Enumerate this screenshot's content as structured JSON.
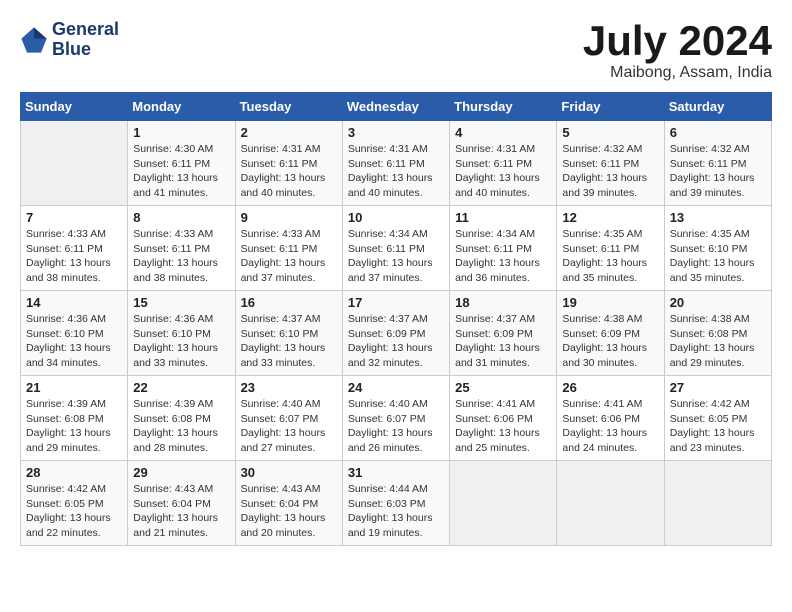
{
  "header": {
    "logo_line1": "General",
    "logo_line2": "Blue",
    "month_year": "July 2024",
    "location": "Maibong, Assam, India"
  },
  "weekdays": [
    "Sunday",
    "Monday",
    "Tuesday",
    "Wednesday",
    "Thursday",
    "Friday",
    "Saturday"
  ],
  "weeks": [
    [
      {
        "day": "",
        "info": ""
      },
      {
        "day": "1",
        "info": "Sunrise: 4:30 AM\nSunset: 6:11 PM\nDaylight: 13 hours\nand 41 minutes."
      },
      {
        "day": "2",
        "info": "Sunrise: 4:31 AM\nSunset: 6:11 PM\nDaylight: 13 hours\nand 40 minutes."
      },
      {
        "day": "3",
        "info": "Sunrise: 4:31 AM\nSunset: 6:11 PM\nDaylight: 13 hours\nand 40 minutes."
      },
      {
        "day": "4",
        "info": "Sunrise: 4:31 AM\nSunset: 6:11 PM\nDaylight: 13 hours\nand 40 minutes."
      },
      {
        "day": "5",
        "info": "Sunrise: 4:32 AM\nSunset: 6:11 PM\nDaylight: 13 hours\nand 39 minutes."
      },
      {
        "day": "6",
        "info": "Sunrise: 4:32 AM\nSunset: 6:11 PM\nDaylight: 13 hours\nand 39 minutes."
      }
    ],
    [
      {
        "day": "7",
        "info": "Sunrise: 4:33 AM\nSunset: 6:11 PM\nDaylight: 13 hours\nand 38 minutes."
      },
      {
        "day": "8",
        "info": "Sunrise: 4:33 AM\nSunset: 6:11 PM\nDaylight: 13 hours\nand 38 minutes."
      },
      {
        "day": "9",
        "info": "Sunrise: 4:33 AM\nSunset: 6:11 PM\nDaylight: 13 hours\nand 37 minutes."
      },
      {
        "day": "10",
        "info": "Sunrise: 4:34 AM\nSunset: 6:11 PM\nDaylight: 13 hours\nand 37 minutes."
      },
      {
        "day": "11",
        "info": "Sunrise: 4:34 AM\nSunset: 6:11 PM\nDaylight: 13 hours\nand 36 minutes."
      },
      {
        "day": "12",
        "info": "Sunrise: 4:35 AM\nSunset: 6:11 PM\nDaylight: 13 hours\nand 35 minutes."
      },
      {
        "day": "13",
        "info": "Sunrise: 4:35 AM\nSunset: 6:10 PM\nDaylight: 13 hours\nand 35 minutes."
      }
    ],
    [
      {
        "day": "14",
        "info": "Sunrise: 4:36 AM\nSunset: 6:10 PM\nDaylight: 13 hours\nand 34 minutes."
      },
      {
        "day": "15",
        "info": "Sunrise: 4:36 AM\nSunset: 6:10 PM\nDaylight: 13 hours\nand 33 minutes."
      },
      {
        "day": "16",
        "info": "Sunrise: 4:37 AM\nSunset: 6:10 PM\nDaylight: 13 hours\nand 33 minutes."
      },
      {
        "day": "17",
        "info": "Sunrise: 4:37 AM\nSunset: 6:09 PM\nDaylight: 13 hours\nand 32 minutes."
      },
      {
        "day": "18",
        "info": "Sunrise: 4:37 AM\nSunset: 6:09 PM\nDaylight: 13 hours\nand 31 minutes."
      },
      {
        "day": "19",
        "info": "Sunrise: 4:38 AM\nSunset: 6:09 PM\nDaylight: 13 hours\nand 30 minutes."
      },
      {
        "day": "20",
        "info": "Sunrise: 4:38 AM\nSunset: 6:08 PM\nDaylight: 13 hours\nand 29 minutes."
      }
    ],
    [
      {
        "day": "21",
        "info": "Sunrise: 4:39 AM\nSunset: 6:08 PM\nDaylight: 13 hours\nand 29 minutes."
      },
      {
        "day": "22",
        "info": "Sunrise: 4:39 AM\nSunset: 6:08 PM\nDaylight: 13 hours\nand 28 minutes."
      },
      {
        "day": "23",
        "info": "Sunrise: 4:40 AM\nSunset: 6:07 PM\nDaylight: 13 hours\nand 27 minutes."
      },
      {
        "day": "24",
        "info": "Sunrise: 4:40 AM\nSunset: 6:07 PM\nDaylight: 13 hours\nand 26 minutes."
      },
      {
        "day": "25",
        "info": "Sunrise: 4:41 AM\nSunset: 6:06 PM\nDaylight: 13 hours\nand 25 minutes."
      },
      {
        "day": "26",
        "info": "Sunrise: 4:41 AM\nSunset: 6:06 PM\nDaylight: 13 hours\nand 24 minutes."
      },
      {
        "day": "27",
        "info": "Sunrise: 4:42 AM\nSunset: 6:05 PM\nDaylight: 13 hours\nand 23 minutes."
      }
    ],
    [
      {
        "day": "28",
        "info": "Sunrise: 4:42 AM\nSunset: 6:05 PM\nDaylight: 13 hours\nand 22 minutes."
      },
      {
        "day": "29",
        "info": "Sunrise: 4:43 AM\nSunset: 6:04 PM\nDaylight: 13 hours\nand 21 minutes."
      },
      {
        "day": "30",
        "info": "Sunrise: 4:43 AM\nSunset: 6:04 PM\nDaylight: 13 hours\nand 20 minutes."
      },
      {
        "day": "31",
        "info": "Sunrise: 4:44 AM\nSunset: 6:03 PM\nDaylight: 13 hours\nand 19 minutes."
      },
      {
        "day": "",
        "info": ""
      },
      {
        "day": "",
        "info": ""
      },
      {
        "day": "",
        "info": ""
      }
    ]
  ]
}
